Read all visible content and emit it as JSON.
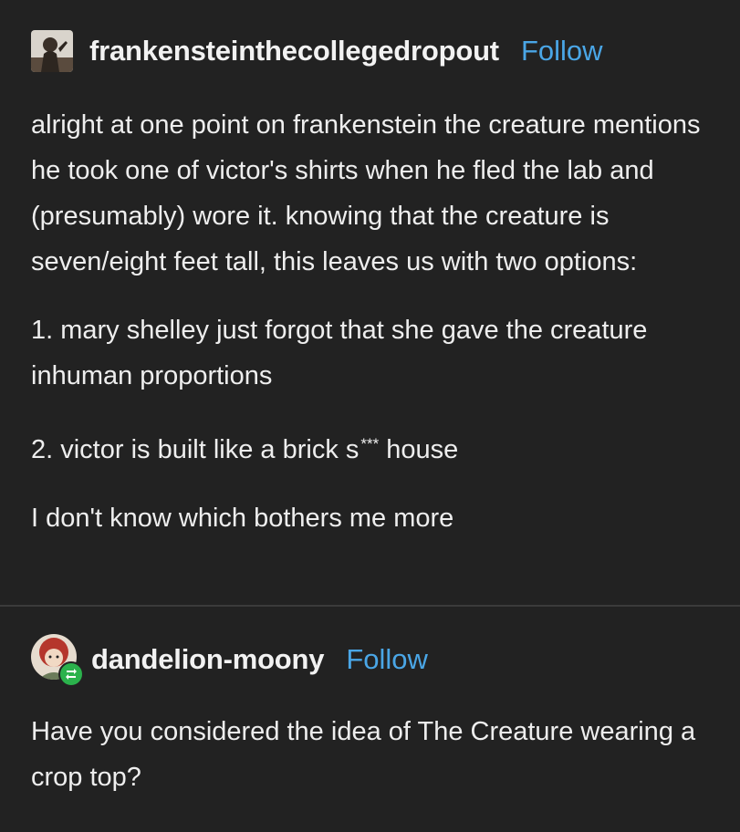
{
  "post1": {
    "username": "frankensteinthecollegedropout",
    "follow_label": "Follow",
    "paragraph1": "alright at one point on frankenstein the creature mentions he took one of victor's shirts when he fled the lab and (presumably) wore it. knowing that the creature is seven/eight feet tall, this leaves us with two options:",
    "option1": "1. mary shelley just forgot that she gave the creature inhuman proportions",
    "option2_prefix": "2. victor is built like a brick s",
    "option2_stars": "***",
    "option2_suffix": "house",
    "closing": "I don't know which bothers me more"
  },
  "post2": {
    "username": "dandelion-moony",
    "follow_label": "Follow",
    "text": "Have you considered the idea of The Creature wearing a crop top?"
  },
  "colors": {
    "background": "#222222",
    "text": "#eeeeee",
    "follow": "#4aa6e6",
    "reblog_badge": "#2bb24c"
  },
  "icons": {
    "avatar1": "bust-sculpture-avatar",
    "avatar2": "red-haired-character-avatar",
    "reblog": "reblog-icon"
  }
}
